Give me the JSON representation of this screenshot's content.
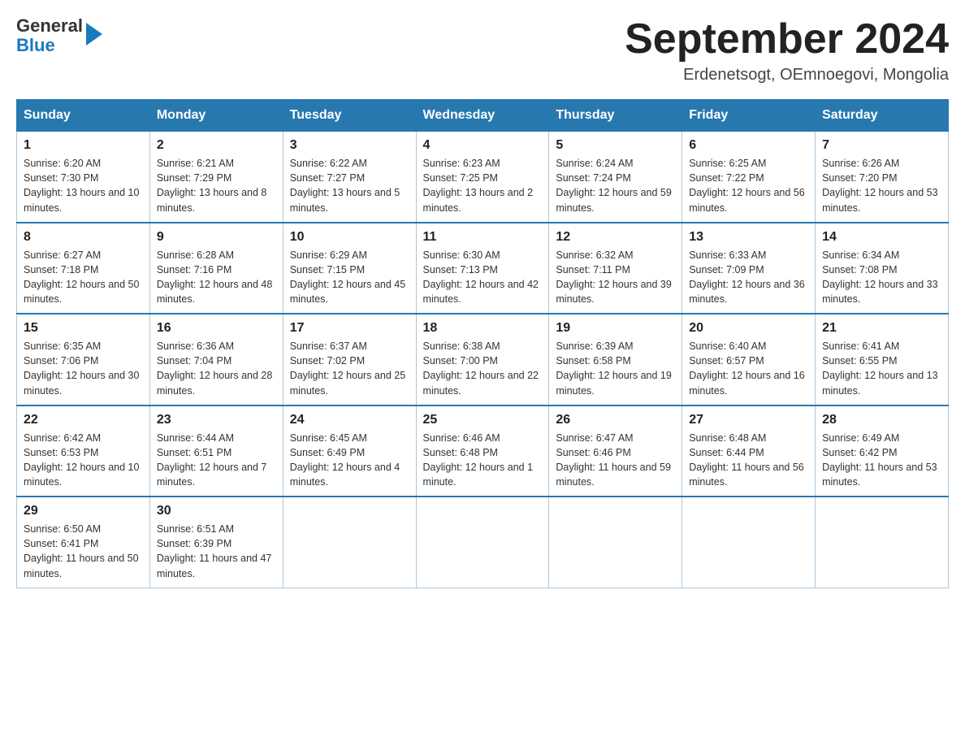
{
  "header": {
    "logo_text_general": "General",
    "logo_text_blue": "Blue",
    "month_title": "September 2024",
    "location": "Erdenetsogt, OEmnoegovi, Mongolia"
  },
  "weekdays": [
    "Sunday",
    "Monday",
    "Tuesday",
    "Wednesday",
    "Thursday",
    "Friday",
    "Saturday"
  ],
  "weeks": [
    [
      {
        "day": "1",
        "sunrise": "6:20 AM",
        "sunset": "7:30 PM",
        "daylight": "13 hours and 10 minutes."
      },
      {
        "day": "2",
        "sunrise": "6:21 AM",
        "sunset": "7:29 PM",
        "daylight": "13 hours and 8 minutes."
      },
      {
        "day": "3",
        "sunrise": "6:22 AM",
        "sunset": "7:27 PM",
        "daylight": "13 hours and 5 minutes."
      },
      {
        "day": "4",
        "sunrise": "6:23 AM",
        "sunset": "7:25 PM",
        "daylight": "13 hours and 2 minutes."
      },
      {
        "day": "5",
        "sunrise": "6:24 AM",
        "sunset": "7:24 PM",
        "daylight": "12 hours and 59 minutes."
      },
      {
        "day": "6",
        "sunrise": "6:25 AM",
        "sunset": "7:22 PM",
        "daylight": "12 hours and 56 minutes."
      },
      {
        "day": "7",
        "sunrise": "6:26 AM",
        "sunset": "7:20 PM",
        "daylight": "12 hours and 53 minutes."
      }
    ],
    [
      {
        "day": "8",
        "sunrise": "6:27 AM",
        "sunset": "7:18 PM",
        "daylight": "12 hours and 50 minutes."
      },
      {
        "day": "9",
        "sunrise": "6:28 AM",
        "sunset": "7:16 PM",
        "daylight": "12 hours and 48 minutes."
      },
      {
        "day": "10",
        "sunrise": "6:29 AM",
        "sunset": "7:15 PM",
        "daylight": "12 hours and 45 minutes."
      },
      {
        "day": "11",
        "sunrise": "6:30 AM",
        "sunset": "7:13 PM",
        "daylight": "12 hours and 42 minutes."
      },
      {
        "day": "12",
        "sunrise": "6:32 AM",
        "sunset": "7:11 PM",
        "daylight": "12 hours and 39 minutes."
      },
      {
        "day": "13",
        "sunrise": "6:33 AM",
        "sunset": "7:09 PM",
        "daylight": "12 hours and 36 minutes."
      },
      {
        "day": "14",
        "sunrise": "6:34 AM",
        "sunset": "7:08 PM",
        "daylight": "12 hours and 33 minutes."
      }
    ],
    [
      {
        "day": "15",
        "sunrise": "6:35 AM",
        "sunset": "7:06 PM",
        "daylight": "12 hours and 30 minutes."
      },
      {
        "day": "16",
        "sunrise": "6:36 AM",
        "sunset": "7:04 PM",
        "daylight": "12 hours and 28 minutes."
      },
      {
        "day": "17",
        "sunrise": "6:37 AM",
        "sunset": "7:02 PM",
        "daylight": "12 hours and 25 minutes."
      },
      {
        "day": "18",
        "sunrise": "6:38 AM",
        "sunset": "7:00 PM",
        "daylight": "12 hours and 22 minutes."
      },
      {
        "day": "19",
        "sunrise": "6:39 AM",
        "sunset": "6:58 PM",
        "daylight": "12 hours and 19 minutes."
      },
      {
        "day": "20",
        "sunrise": "6:40 AM",
        "sunset": "6:57 PM",
        "daylight": "12 hours and 16 minutes."
      },
      {
        "day": "21",
        "sunrise": "6:41 AM",
        "sunset": "6:55 PM",
        "daylight": "12 hours and 13 minutes."
      }
    ],
    [
      {
        "day": "22",
        "sunrise": "6:42 AM",
        "sunset": "6:53 PM",
        "daylight": "12 hours and 10 minutes."
      },
      {
        "day": "23",
        "sunrise": "6:44 AM",
        "sunset": "6:51 PM",
        "daylight": "12 hours and 7 minutes."
      },
      {
        "day": "24",
        "sunrise": "6:45 AM",
        "sunset": "6:49 PM",
        "daylight": "12 hours and 4 minutes."
      },
      {
        "day": "25",
        "sunrise": "6:46 AM",
        "sunset": "6:48 PM",
        "daylight": "12 hours and 1 minute."
      },
      {
        "day": "26",
        "sunrise": "6:47 AM",
        "sunset": "6:46 PM",
        "daylight": "11 hours and 59 minutes."
      },
      {
        "day": "27",
        "sunrise": "6:48 AM",
        "sunset": "6:44 PM",
        "daylight": "11 hours and 56 minutes."
      },
      {
        "day": "28",
        "sunrise": "6:49 AM",
        "sunset": "6:42 PM",
        "daylight": "11 hours and 53 minutes."
      }
    ],
    [
      {
        "day": "29",
        "sunrise": "6:50 AM",
        "sunset": "6:41 PM",
        "daylight": "11 hours and 50 minutes."
      },
      {
        "day": "30",
        "sunrise": "6:51 AM",
        "sunset": "6:39 PM",
        "daylight": "11 hours and 47 minutes."
      },
      null,
      null,
      null,
      null,
      null
    ]
  ]
}
